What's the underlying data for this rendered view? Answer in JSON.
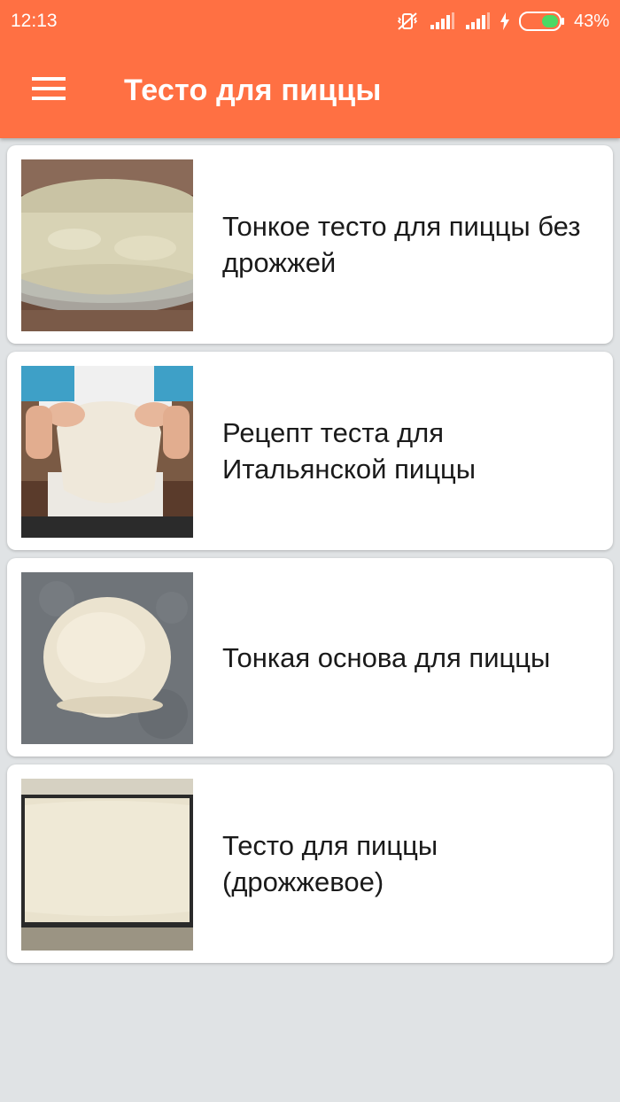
{
  "status_bar": {
    "time": "12:13",
    "battery": "43%",
    "icons": [
      "vibrate-off-icon",
      "signal-icon",
      "signal-icon",
      "charging-icon",
      "battery-icon"
    ]
  },
  "toolbar": {
    "title": "Тесто для пиццы",
    "menu_icon": "hamburger-menu-icon"
  },
  "colors": {
    "accent": "#ff7043",
    "background": "#e0e3e5",
    "card": "#ffffff"
  },
  "recipes": [
    {
      "title": "Тонкое тесто для пиццы без дрожжей",
      "image": "dough-in-glass-bowl"
    },
    {
      "title": "Рецепт теста для Итальянской пиццы",
      "image": "hands-stretching-dough"
    },
    {
      "title": "Тонкая основа для пиццы",
      "image": "round-dough-on-stone"
    },
    {
      "title": "Тесто для пиццы (дрожжевое)",
      "image": "dough-on-baking-sheet"
    }
  ]
}
